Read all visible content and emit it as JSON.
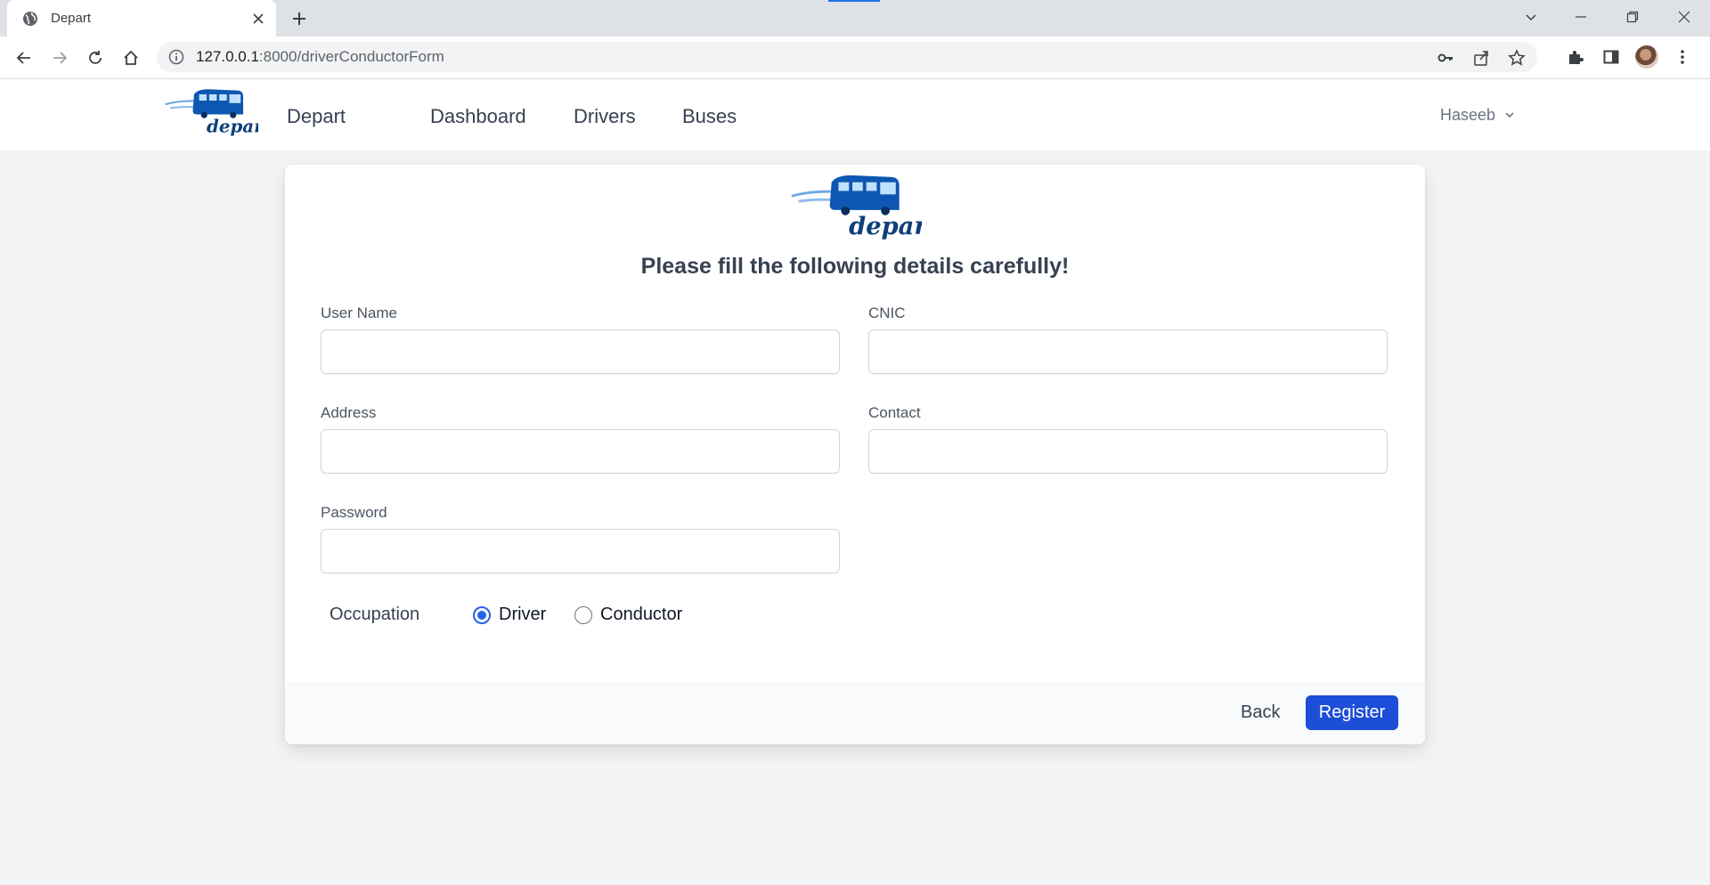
{
  "browser": {
    "tab_title": "Depart",
    "url_host": "127.0.0.1",
    "url_path": ":8000/driverConductorForm"
  },
  "navbar": {
    "brand": "Depart",
    "links": [
      "Dashboard",
      "Drivers",
      "Buses"
    ],
    "user": "Haseeb"
  },
  "logo_text": "depart",
  "form": {
    "heading": "Please fill the following details carefully!",
    "fields": {
      "username": {
        "label": "User Name",
        "value": ""
      },
      "cnic": {
        "label": "CNIC",
        "value": ""
      },
      "address": {
        "label": "Address",
        "value": ""
      },
      "contact": {
        "label": "Contact",
        "value": ""
      },
      "password": {
        "label": "Password",
        "value": ""
      }
    },
    "occupation": {
      "label": "Occupation",
      "options": [
        "Driver",
        "Conductor"
      ],
      "selected": "Driver"
    },
    "back_label": "Back",
    "register_label": "Register"
  },
  "colors": {
    "accent": "#1d4ed8",
    "radio": "#2563eb",
    "page_bg": "#f3f4f6",
    "logo_blue": "#0d4d9c"
  }
}
